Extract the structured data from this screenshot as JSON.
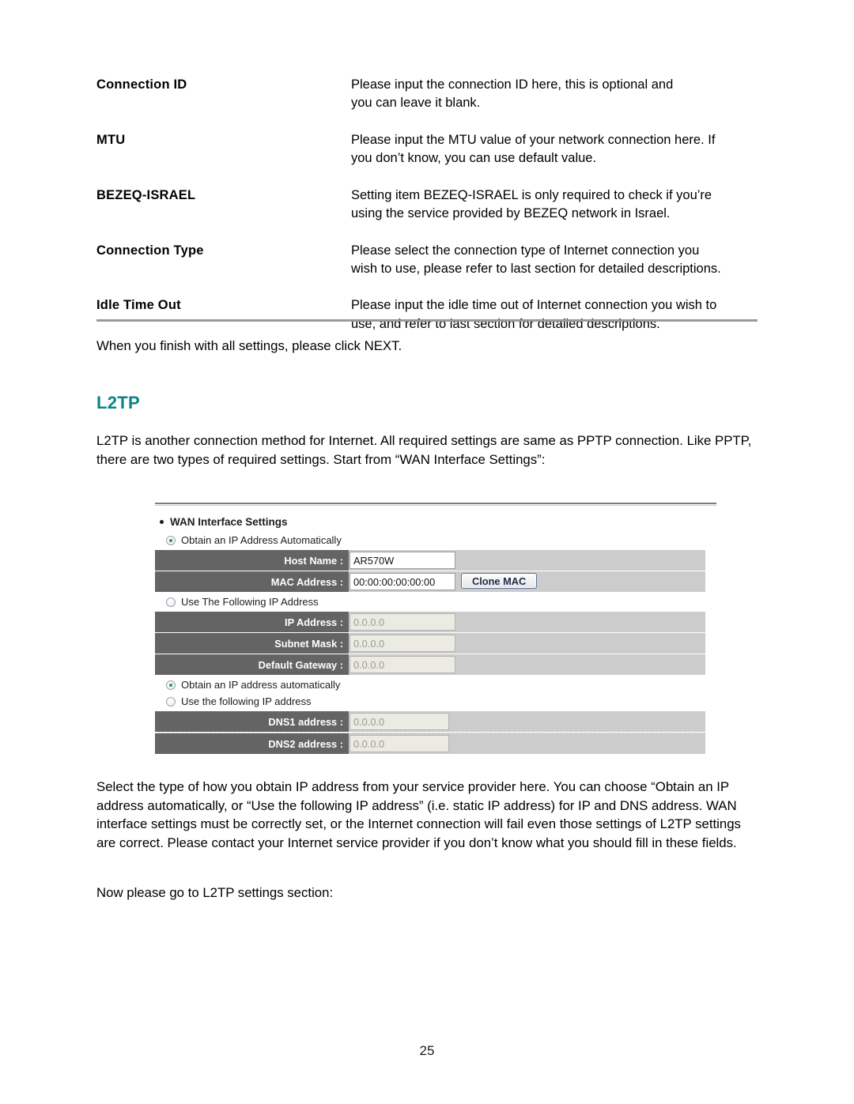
{
  "definitions": [
    {
      "term": "Connection ID",
      "description": "Please input the connection ID here, this is optional and\nyou can leave it blank."
    },
    {
      "term": "MTU",
      "description": "Please input the MTU value of your network connection here. If\nyou don’t know, you can use default value."
    },
    {
      "term": "BEZEQ-ISRAEL",
      "description": "Setting item BEZEQ-ISRAEL is only required to check if you’re\nusing the service provided by BEZEQ network in Israel."
    },
    {
      "term": "Connection Type",
      "description": "Please select the connection type of Internet connection you\nwish to use, please refer to last section for detailed descriptions."
    },
    {
      "term": "Idle Time Out",
      "description": "Please input the idle time out of Internet connection you wish to\nuse, and refer to last section for detailed descriptions."
    }
  ],
  "next_note": "When you finish with all settings, please click NEXT.",
  "section": {
    "heading": "L2TP",
    "heading_color": "#0c8285",
    "intro": "L2TP is another connection method for Internet. All required settings are same as PPTP connection. Like PPTP, there are two types of required settings. Start from “WAN Interface Settings”:"
  },
  "screenshot": {
    "title": "WAN Interface Settings",
    "radio_obtain_auto_upper": "Obtain an IP Address Automatically",
    "radio_use_following_upper": "Use The Following IP Address",
    "radio_obtain_auto_lower": "Obtain an IP address automatically",
    "radio_use_following_lower": "Use the following IP address",
    "clone_mac_label": "Clone MAC",
    "fields": [
      {
        "label": "Host Name :",
        "value": "AR570W",
        "disabled": false
      },
      {
        "label": "MAC Address :",
        "value": "00:00:00:00:00:00",
        "disabled": false
      },
      {
        "label": "IP Address :",
        "value": "0.0.0.0",
        "disabled": true
      },
      {
        "label": "Subnet Mask :",
        "value": "0.0.0.0",
        "disabled": true
      },
      {
        "label": "Default Gateway :",
        "value": "0.0.0.0",
        "disabled": true
      },
      {
        "label": "DNS1 address :",
        "value": "0.0.0.0",
        "disabled": true
      },
      {
        "label": "DNS2 address :",
        "value": "0.0.0.0",
        "disabled": true
      }
    ]
  },
  "body": {
    "paragraph_select_type": "Select the type of how you obtain IP address from your service provider here. You can choose “Obtain an IP address automatically, or “Use the following IP address” (i.e. static IP address) for IP and DNS address. WAN interface settings must be correctly set, or the Internet connection will fail even those settings of L2TP settings are correct. Please contact your Internet service provider if you don’t know what you should fill in these fields.",
    "paragraph_now_go": "Now please go to L2TP settings section:"
  },
  "footer": {
    "page_number": "25"
  }
}
